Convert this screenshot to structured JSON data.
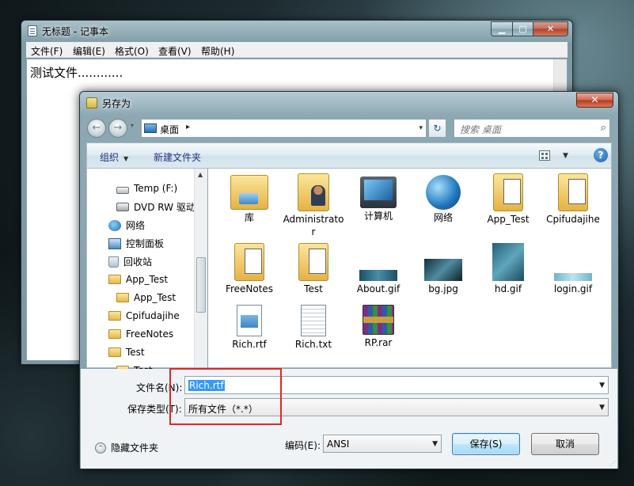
{
  "notepad": {
    "title": "无标题 - 记事本",
    "min_label": "▁",
    "max_label": "▢",
    "close_label": "✕",
    "menus": [
      "文件(F)",
      "编辑(E)",
      "格式(O)",
      "查看(V)",
      "帮助(H)"
    ],
    "content": "测试文件............"
  },
  "dialog": {
    "title": "另存为",
    "close_label": "✕",
    "address": {
      "location": "桌面",
      "separator": "▸",
      "dropdown": "▾",
      "refresh": "↻"
    },
    "search": {
      "placeholder": "搜索 桌面",
      "icon": "⌕"
    },
    "nav": {
      "back": "←",
      "forward": "→",
      "history": "▾"
    },
    "commandbar": {
      "organize": "组织",
      "organize_arrow": "▼",
      "new_folder": "新建文件夹",
      "view_dropdown": "▼",
      "help": "?"
    },
    "navpane": {
      "items": [
        {
          "label": "Temp (F:)",
          "icon": "drive-icon"
        },
        {
          "label": "DVD RW 驱动",
          "icon": "dvd-drive-icon"
        },
        {
          "label": "网络",
          "icon": "network-icon"
        },
        {
          "label": "控制面板",
          "icon": "control-panel-icon"
        },
        {
          "label": "回收站",
          "icon": "recycle-bin-icon"
        },
        {
          "label": "App_Test",
          "icon": "folder-icon"
        },
        {
          "label": "App_Test",
          "icon": "folder-icon"
        },
        {
          "label": "Cpifudajihe",
          "icon": "folder-icon"
        },
        {
          "label": "FreeNotes",
          "icon": "folder-icon"
        },
        {
          "label": "Test",
          "icon": "folder-icon"
        },
        {
          "label": "Test",
          "icon": "folder-icon"
        }
      ],
      "scroll_up": "▲"
    },
    "files": [
      {
        "label": "库",
        "icon": "library-icon"
      },
      {
        "label": "Administrator",
        "icon": "user-folder-icon"
      },
      {
        "label": "计算机",
        "icon": "computer-icon"
      },
      {
        "label": "网络",
        "icon": "network-icon"
      },
      {
        "label": "App_Test",
        "icon": "folder-icon"
      },
      {
        "label": "Cpifudajihe",
        "icon": "folder-icon"
      },
      {
        "label": "FreeNotes",
        "icon": "folder-icon"
      },
      {
        "label": "Test",
        "icon": "folder-icon"
      },
      {
        "label": "About.gif",
        "icon": "image-icon"
      },
      {
        "label": "bg.jpg",
        "icon": "image-icon"
      },
      {
        "label": "hd.gif",
        "icon": "image-icon"
      },
      {
        "label": "login.gif",
        "icon": "image-icon"
      },
      {
        "label": "Rich.rtf",
        "icon": "rtf-document-icon"
      },
      {
        "label": "Rich.txt",
        "icon": "text-document-icon"
      },
      {
        "label": "RP.rar",
        "icon": "rar-archive-icon"
      }
    ],
    "filename": {
      "label": "文件名(N):",
      "value": "Rich.rtf"
    },
    "filetype": {
      "label": "保存类型(T):",
      "value": "所有文件（*.*）"
    },
    "hide_folders": {
      "label": "隐藏文件夹",
      "icon": "^"
    },
    "encoding": {
      "label": "编码(E):",
      "value": "ANSI"
    },
    "save_label": "保存(S)",
    "cancel_label": "取消",
    "combo_arrow": "▼"
  }
}
